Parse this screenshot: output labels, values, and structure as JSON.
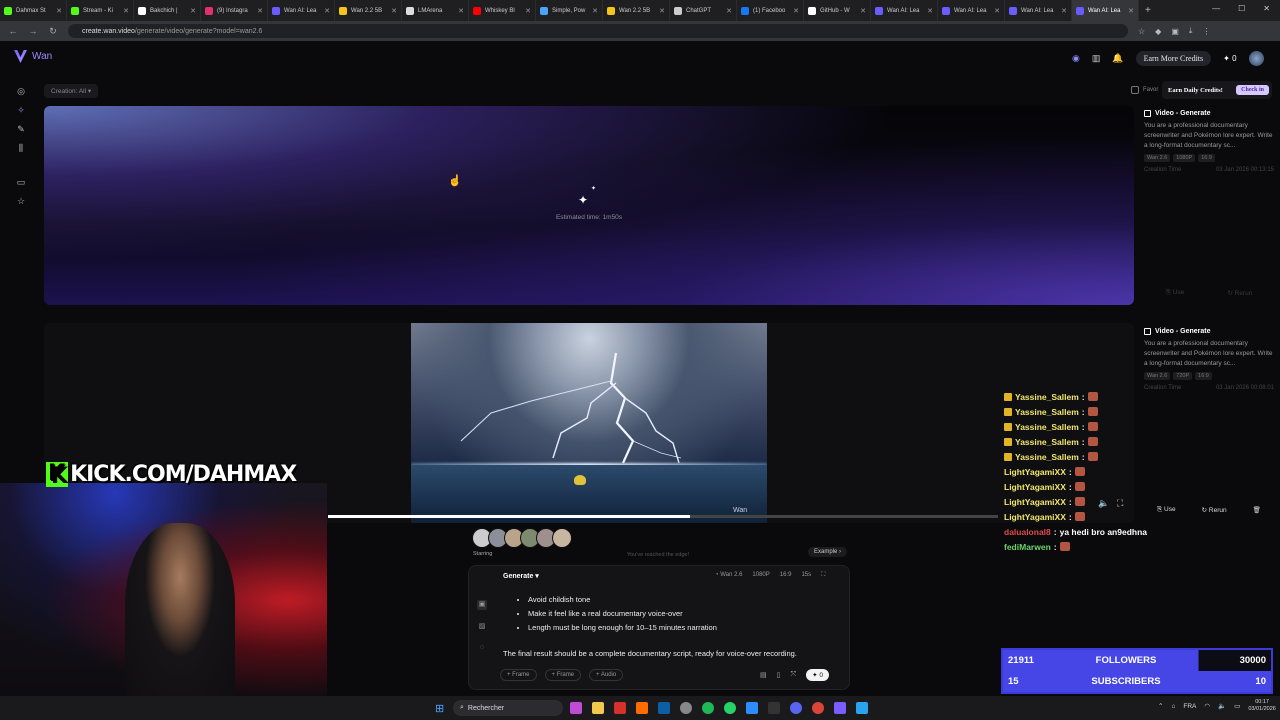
{
  "browser": {
    "tabs": [
      {
        "label": "Dahmax St",
        "color": "#53fc18"
      },
      {
        "label": "Stream - Ki",
        "color": "#53fc18"
      },
      {
        "label": "Bakchich | ",
        "color": "#ffffff"
      },
      {
        "label": "(9) Instagra",
        "color": "#e1306c"
      },
      {
        "label": "Wan AI: Lea",
        "color": "#6a5cff"
      },
      {
        "label": "Wan 2.2 5B",
        "color": "#f5c518"
      },
      {
        "label": "LMArena",
        "color": "#dddddd"
      },
      {
        "label": "Whiskey Bl",
        "color": "#ff0000"
      },
      {
        "label": "Simple, Pow",
        "color": "#4aa3ff"
      },
      {
        "label": "Wan 2.2 5B",
        "color": "#f5c518"
      },
      {
        "label": "ChatGPT",
        "color": "#cccccc"
      },
      {
        "label": "(1) Faceboo",
        "color": "#1877f2"
      },
      {
        "label": "GitHub - W",
        "color": "#ffffff"
      },
      {
        "label": "Wan AI: Lea",
        "color": "#6a5cff"
      },
      {
        "label": "Wan AI: Lea",
        "color": "#6a5cff"
      },
      {
        "label": "Wan AI: Lea",
        "color": "#6a5cff"
      },
      {
        "label": "Wan AI: Lea",
        "color": "#6a5cff",
        "active": true
      }
    ],
    "url_host": "create.wan.video",
    "url_path": "/generate/video/generate?model=wan2.6"
  },
  "app": {
    "logo_text": "Wan",
    "earn_more_label": "Earn More Credits",
    "credits": "0",
    "creation_filter": "Creation: All",
    "favorites_label": "Favor",
    "daily_credits_label": "Earn Daily Credits!",
    "check_in_label": "Check in",
    "estimated_time": "Estimated time: 1m50s"
  },
  "panels": [
    {
      "title": "Video - Generate",
      "desc": "You are a professional documentary screenwriter and Pokémon lore expert. Write a long-format documentary sc...",
      "tags": [
        "Wan 2.6",
        "1080P",
        "16:9"
      ],
      "time_label": "Creation Time",
      "time_value": "03 Jan 2026 00:13:15",
      "use_label": "Use",
      "rerun_label": "Rerun"
    },
    {
      "title": "Video - Generate",
      "desc": "You are a professional documentary screenwriter and Pokémon lore expert. Write a long-format documentary sc...",
      "tags": [
        "Wan 2.6",
        "720P",
        "16:9"
      ],
      "time_label": "Creation Time",
      "time_value": "03 Jan 2026 00:08:01",
      "use_label": "Use",
      "rerun_label": "Rerun"
    }
  ],
  "video": {
    "progress_fraction": 0.54,
    "watermark": "Wan"
  },
  "chat": [
    {
      "user": "Yassine_Sallem",
      "color": "#f3e86a",
      "badge": true,
      "msg": ""
    },
    {
      "user": "Yassine_Sallem",
      "color": "#f3e86a",
      "badge": true,
      "msg": ""
    },
    {
      "user": "Yassine_Sallem",
      "color": "#f3e86a",
      "badge": true,
      "msg": ""
    },
    {
      "user": "Yassine_Sallem",
      "color": "#f3e86a",
      "badge": true,
      "msg": ""
    },
    {
      "user": "Yassine_Sallem",
      "color": "#f3e86a",
      "badge": true,
      "msg": ""
    },
    {
      "user": "LightYagamiXX",
      "color": "#f3e86a",
      "badge": false,
      "msg": ""
    },
    {
      "user": "LightYagamiXX",
      "color": "#f3e86a",
      "badge": false,
      "msg": ""
    },
    {
      "user": "LightYagamiXX",
      "color": "#f3e86a",
      "badge": false,
      "msg": ""
    },
    {
      "user": "LightYagamiXX",
      "color": "#f3e86a",
      "badge": false,
      "msg": ""
    },
    {
      "user": "dalualonal8",
      "color": "#e24a4a",
      "badge": false,
      "msg": "ya hedi bro an9edhna"
    },
    {
      "user": "fediMarwen",
      "color": "#6ad46a",
      "badge": false,
      "msg": ""
    }
  ],
  "prompt": {
    "starring_label": "Starring",
    "edge_text": "You've reached the edge!",
    "example_label": "Example",
    "mode_label": "Generate",
    "options": [
      "Wan 2.6",
      "1080P",
      "16:9",
      "15s"
    ],
    "bullets": [
      "Avoid childish tone",
      "Make it feel like a real documentary voice-over",
      "Length must be long enough for 10–15 minutes narration"
    ],
    "final_line": "The final result should be a complete documentary script, ready for voice-over recording.",
    "frame_label": "Frame",
    "frame2_label": "Frame",
    "audio_label": "Audio",
    "send_count": "0"
  },
  "overlay": {
    "kick_url": "KICK.COM/DAHMAX"
  },
  "stats": {
    "followers_current": "21911",
    "followers_label": "FOLLOWERS",
    "followers_goal": "30000",
    "subscribers_current": "15",
    "subscribers_label": "SUBSCRIBERS",
    "subscribers_goal": "10"
  },
  "taskbar": {
    "search_label": "Rechercher",
    "lang": "FRA",
    "time": "00:17",
    "date": "03/01/2026"
  }
}
